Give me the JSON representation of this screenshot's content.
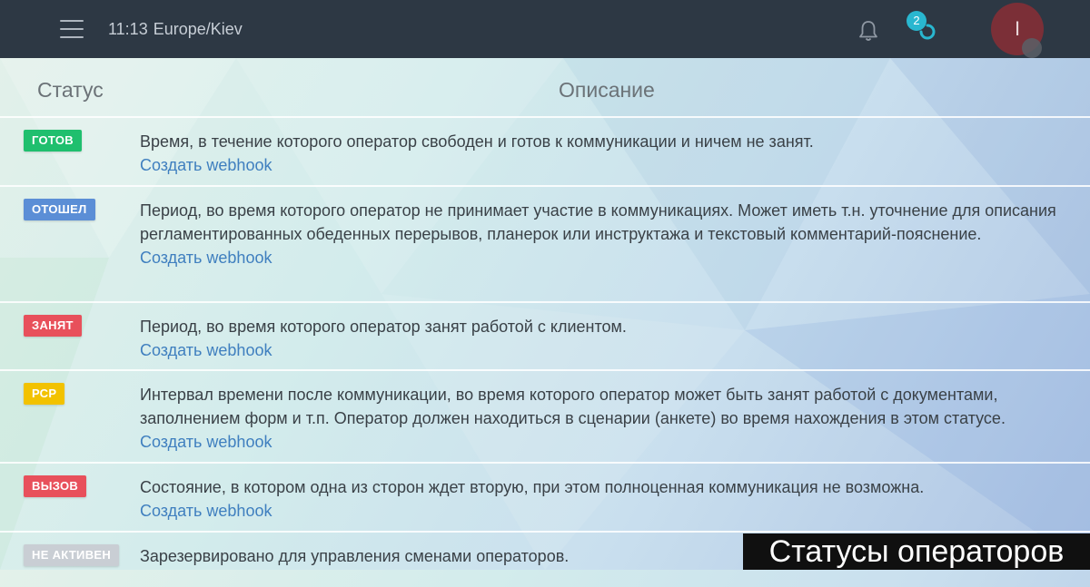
{
  "header": {
    "time": "11:13",
    "timezone": "Europe/Kiev",
    "notification_count": "2",
    "avatar_initial": "I"
  },
  "table": {
    "col_status": "Статус",
    "col_description": "Описание",
    "rows": [
      {
        "badge": "ГОТОВ",
        "color": "#1fbf6e",
        "description": "Время, в течение которого оператор свободен и готов к коммуникации и ничем не занят.",
        "link": "Создать webhook"
      },
      {
        "badge": "ОТОШЕЛ",
        "color": "#5b8ed6",
        "description": "Период, во время которого оператор не принимает участие в коммуникациях. Может иметь т.н. уточнение для описания регламентированных обеденных перерывов, планерок или инструктажа и текстовый комментарий-пояснение.",
        "link": "Создать webhook"
      },
      {
        "badge": "ЗАНЯТ",
        "color": "#e8505b",
        "description": "Период, во время которого оператор занят работой с клиентом.",
        "link": "Создать webhook"
      },
      {
        "badge": "РСР",
        "color": "#f2c200",
        "description": "Интервал времени после коммуникации, во время которого оператор может быть занят работой с документами, заполнением форм и т.п. Оператор должен находиться в сценарии (анкете) во время нахождения в этом статусе.",
        "link": "Создать webhook"
      },
      {
        "badge": "ВЫЗОВ",
        "color": "#e8505b",
        "description": "Состояние, в котором одна из сторон ждет вторую, при этом полноценная коммуникация не возможна.",
        "link": "Создать webhook"
      },
      {
        "badge": "НЕ АКТИВЕН",
        "color": "#c9ced4",
        "description": "Зарезервировано для управления сменами операторов.",
        "link": ""
      }
    ]
  },
  "caption": "Статусы операторов"
}
